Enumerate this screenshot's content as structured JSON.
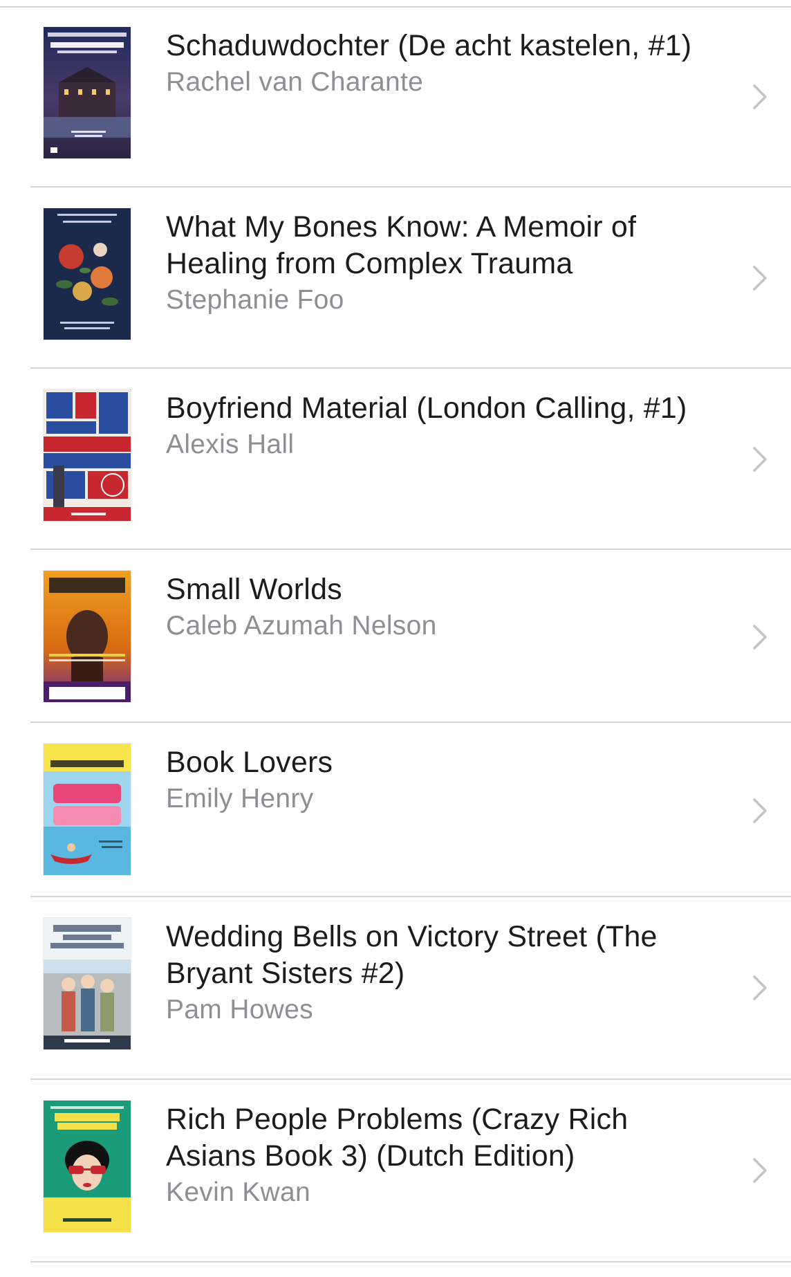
{
  "books": [
    {
      "title": "Schaduwdochter (De acht kastelen, #1)",
      "author": "Rachel van Charante",
      "cover_icon": "book-cover-castle",
      "accent": "#2b2f5a"
    },
    {
      "title": "What My Bones Know: A Memoir of Healing from Complex Trauma",
      "author": "Stephanie Foo",
      "cover_icon": "book-cover-flowers",
      "accent": "#1b2a4a"
    },
    {
      "title": "Boyfriend Material (London Calling, #1)",
      "author": "Alexis Hall",
      "cover_icon": "book-cover-london",
      "accent": "#c8272f"
    },
    {
      "title": "Small Worlds",
      "author": "Caleb Azumah Nelson",
      "cover_icon": "book-cover-portrait",
      "accent": "#e07a1c"
    },
    {
      "title": "Book Lovers",
      "author": "Emily Henry",
      "cover_icon": "book-cover-boat",
      "accent": "#e8457a"
    },
    {
      "title": "Wedding Bells on Victory Street (The Bryant Sisters #2)",
      "author": "Pam Howes",
      "cover_icon": "book-cover-sisters",
      "accent": "#a8c2d8"
    },
    {
      "title": "Rich People Problems (Crazy Rich Asians Book 3) (Dutch Edition)",
      "author": "Kevin Kwan",
      "cover_icon": "book-cover-sunglasses",
      "accent": "#1a9b7a"
    }
  ],
  "colors": {
    "title": "#1c1c1e",
    "author": "#8e8e93",
    "separator": "#d6d6d8",
    "chevron": "#c4c4c7"
  }
}
